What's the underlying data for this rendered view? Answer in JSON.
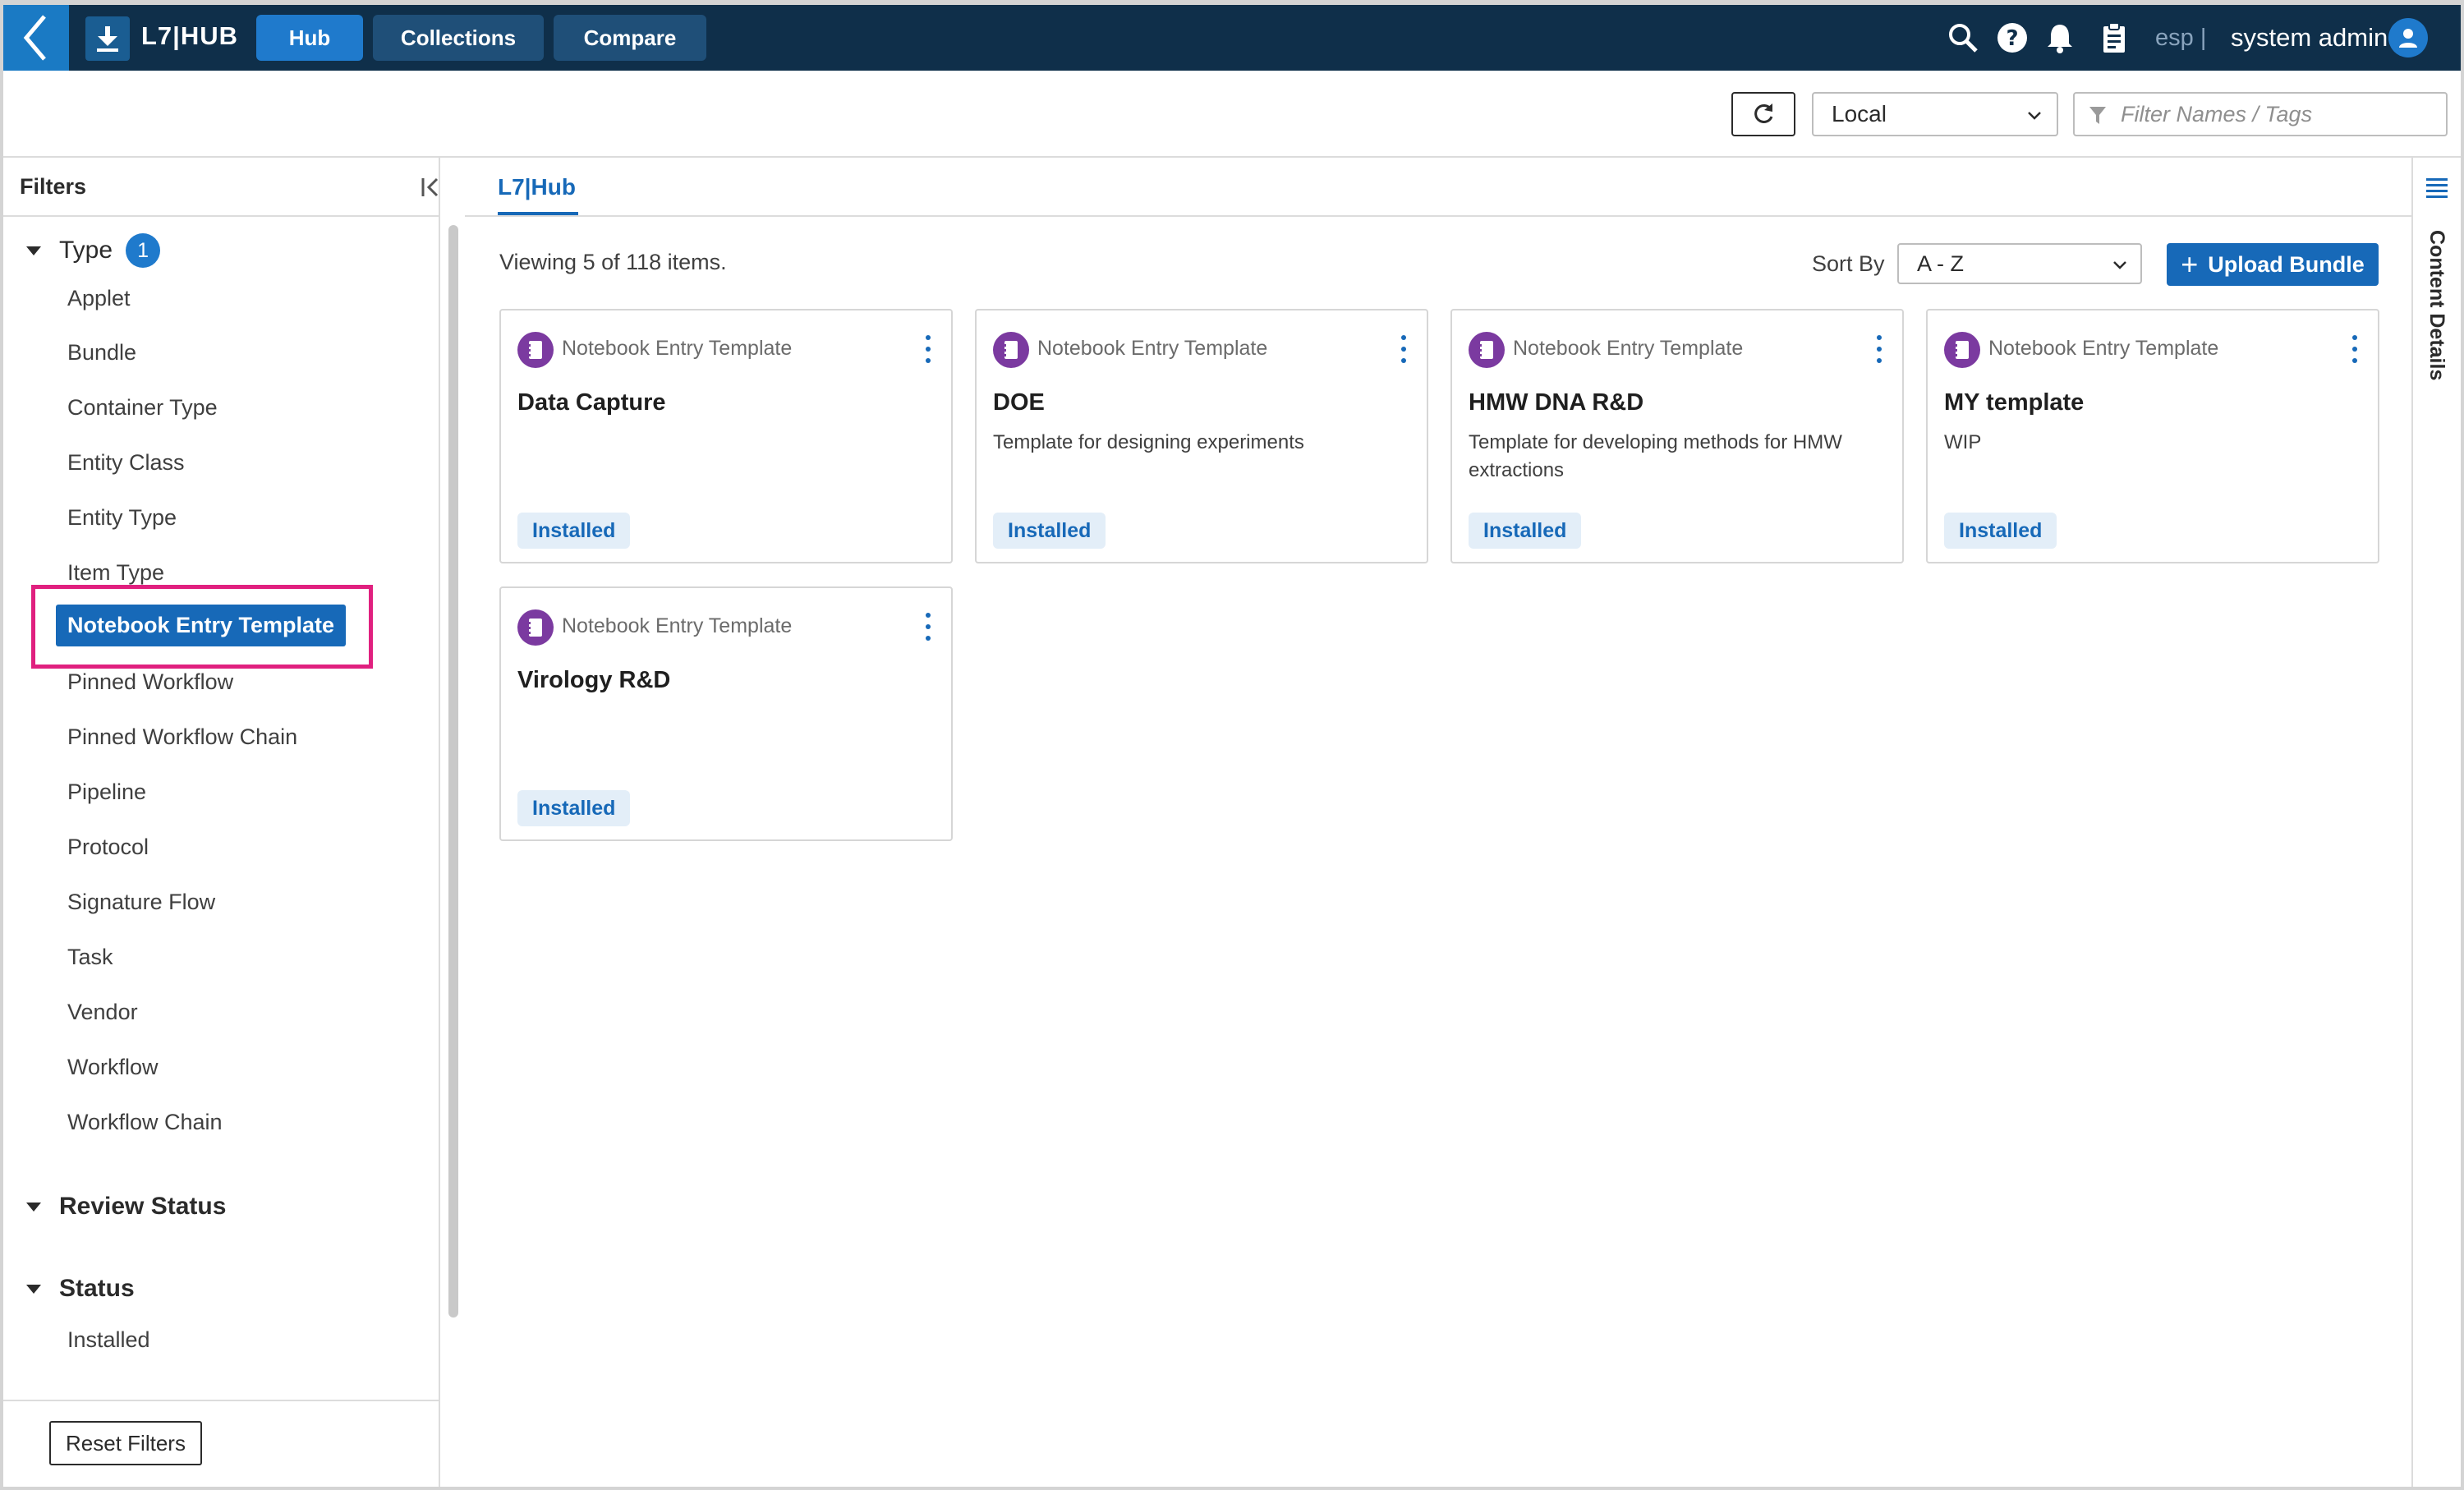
{
  "nav": {
    "brand": "L7|HUB",
    "tabs": [
      {
        "label": "Hub",
        "active": true
      },
      {
        "label": "Collections",
        "active": false
      },
      {
        "label": "Compare",
        "active": false
      }
    ],
    "env": "esp |",
    "user": "system admin"
  },
  "toolbar": {
    "location_value": "Local",
    "filter_placeholder": "Filter Names / Tags"
  },
  "sidebar": {
    "title": "Filters",
    "type_section": {
      "label": "Type",
      "count": "1",
      "items": [
        "Applet",
        "Bundle",
        "Container Type",
        "Entity Class",
        "Entity Type",
        "Item Type",
        "Notebook Entry Template",
        "Pinned Workflow",
        "Pinned Workflow Chain",
        "Pipeline",
        "Protocol",
        "Signature Flow",
        "Task",
        "Vendor",
        "Workflow",
        "Workflow Chain"
      ],
      "selected": "Notebook Entry Template"
    },
    "review_status_section": {
      "label": "Review Status"
    },
    "status_section": {
      "label": "Status",
      "items": [
        "Installed"
      ]
    },
    "reset_label": "Reset Filters"
  },
  "main": {
    "tab_label": "L7|Hub",
    "viewing_text": "Viewing 5 of 118 items.",
    "sort_label": "Sort By",
    "sort_value": "A - Z",
    "upload_label": "Upload Bundle",
    "cards": [
      {
        "type": "Notebook Entry Template",
        "title": "Data Capture",
        "desc": "",
        "status": "Installed"
      },
      {
        "type": "Notebook Entry Template",
        "title": "DOE",
        "desc": "Template for designing experiments",
        "status": "Installed"
      },
      {
        "type": "Notebook Entry Template",
        "title": "HMW DNA R&D",
        "desc": "Template for developing methods for HMW extractions",
        "status": "Installed"
      },
      {
        "type": "Notebook Entry Template",
        "title": "MY template",
        "desc": "WIP",
        "status": "Installed"
      },
      {
        "type": "Notebook Entry Template",
        "title": "Virology R&D",
        "desc": "",
        "status": "Installed"
      }
    ]
  },
  "right_panel": {
    "label": "Content Details"
  },
  "icons": {
    "back": "chevron-left-icon",
    "logo": "download-icon",
    "search": "search-icon",
    "help": "help-icon",
    "notifications": "bell-icon",
    "clipboard": "clipboard-icon",
    "avatar": "user-icon",
    "refresh": "refresh-icon",
    "filter": "funnel-icon",
    "collapse": "collapse-left-icon",
    "card_type": "notebook-icon",
    "more": "kebab-menu-icon",
    "details": "list-icon"
  },
  "colors": {
    "navbar": "#0f2f4a",
    "accent": "#1769b8",
    "nav_active": "#1f7acc",
    "highlight": "#e0207f",
    "card_icon": "#7b3aa0",
    "badge_bg": "#e3eef8"
  }
}
